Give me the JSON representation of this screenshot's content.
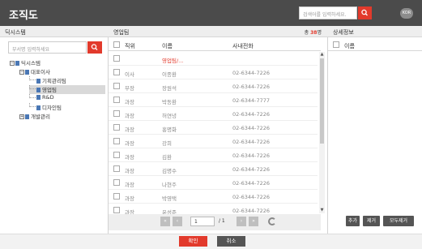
{
  "window": {
    "title": "조직도"
  },
  "top_search": {
    "placeholder": "검색어를 입력하세요."
  },
  "lang_button": "KOR",
  "left": {
    "header": "딕시스템",
    "search_placeholder": "부서명 입력하세요",
    "tree": [
      {
        "label": "딕시스템",
        "toggle": "−"
      },
      {
        "label": "대표이사",
        "toggle": "−"
      },
      {
        "label": "기획관리팀"
      },
      {
        "label": "영업팀"
      },
      {
        "label": "R&D"
      },
      {
        "label": "디자인팀"
      },
      {
        "label": "개발관리",
        "toggle": "+"
      }
    ]
  },
  "middle": {
    "header": "영업팀",
    "count_prefix": "총",
    "count": "38",
    "count_suffix": "명",
    "columns": {
      "position": "직위",
      "name": "이름",
      "phone": "사내전화"
    },
    "rows": [
      {
        "position": "",
        "name": "영업팀/...",
        "phone": ""
      },
      {
        "position": "이사",
        "name": "이종환",
        "phone": "02-6344-7226"
      },
      {
        "position": "부장",
        "name": "장원석",
        "phone": "02-6344-7226"
      },
      {
        "position": "과장",
        "name": "박동환",
        "phone": "02-6344-7777"
      },
      {
        "position": "과장",
        "name": "허연녕",
        "phone": "02-6344-7226"
      },
      {
        "position": "과장",
        "name": "홍명화",
        "phone": "02-6344-7226"
      },
      {
        "position": "과장",
        "name": "강희",
        "phone": "02-6344-7226"
      },
      {
        "position": "과장",
        "name": "김환",
        "phone": "02-6344-7226"
      },
      {
        "position": "과장",
        "name": "김명수",
        "phone": "02-6344-7226"
      },
      {
        "position": "과장",
        "name": "나현주",
        "phone": "02-6344-7226"
      },
      {
        "position": "과장",
        "name": "박영택",
        "phone": "02-6344-7226"
      },
      {
        "position": "과장",
        "name": "윤성준",
        "phone": "02-6344-7226"
      }
    ],
    "pager": {
      "current": "1",
      "total": "/ 1"
    }
  },
  "right": {
    "header": "상세정보",
    "col_name": "이름",
    "buttons": {
      "add": "추가",
      "remove": "제거",
      "remove_all": "모두제거"
    }
  },
  "footer": {
    "ok": "확인",
    "cancel": "취소"
  },
  "colors": {
    "accent": "#e23a2c",
    "titlebar": "#4b4b4b",
    "dark_button": "#555555"
  }
}
